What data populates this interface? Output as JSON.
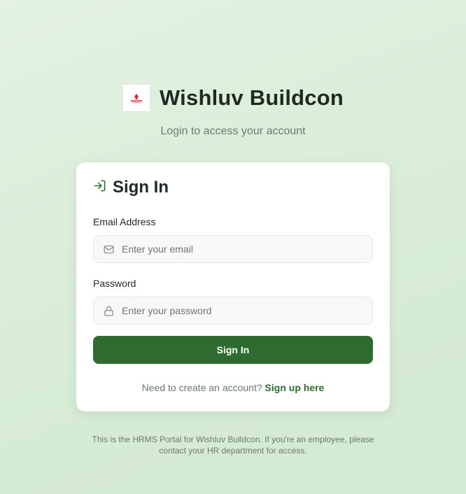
{
  "brand": {
    "name": "Wishluv Buildcon",
    "subtitle": "Login to access your account"
  },
  "card": {
    "title": "Sign In",
    "email": {
      "label": "Email Address",
      "placeholder": "Enter your email",
      "value": ""
    },
    "password": {
      "label": "Password",
      "placeholder": "Enter your password",
      "value": ""
    },
    "submit_label": "Sign In",
    "signup_prompt": "Need to create an account?",
    "signup_link": "Sign up here"
  },
  "footer": {
    "note": "This is the HRMS Portal for Wishluv Buildcon. If you're an employee, please contact your HR department for access."
  },
  "colors": {
    "accent": "#2e6b30",
    "background": "#dcefdb",
    "logo_red": "#d8262c"
  },
  "icons": {
    "logo": "company-logo",
    "sign_in": "log-in-arrow-icon",
    "email": "mail-icon",
    "password": "lock-icon"
  }
}
